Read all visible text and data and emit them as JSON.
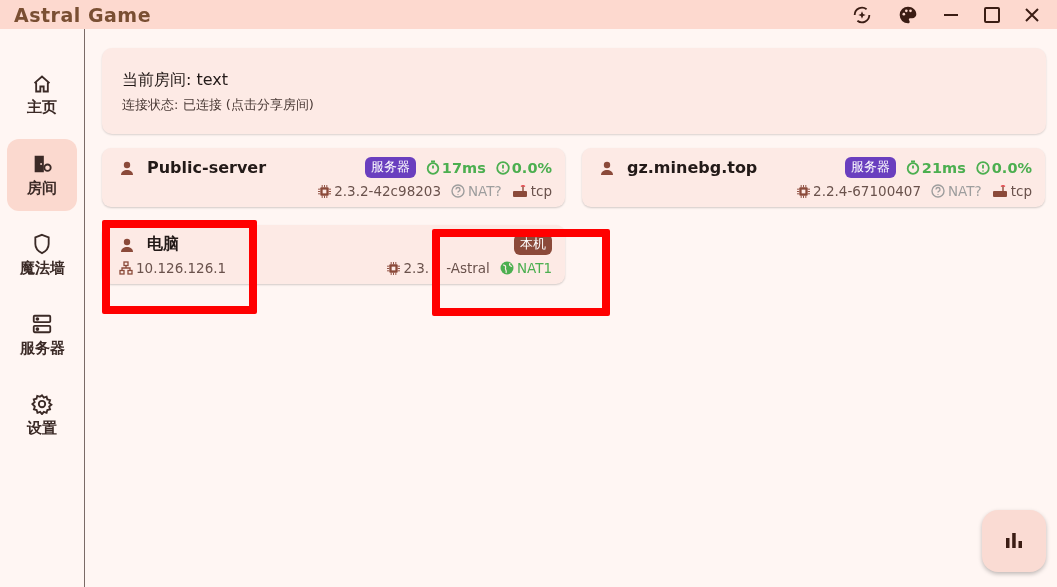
{
  "window": {
    "title": "Astral Game"
  },
  "sidebar": {
    "items": [
      {
        "label": "主页",
        "kind": "home",
        "selected": false
      },
      {
        "label": "房间",
        "kind": "room",
        "selected": true
      },
      {
        "label": "魔法墙",
        "kind": "shield",
        "selected": false
      },
      {
        "label": "服务器",
        "kind": "server",
        "selected": false
      },
      {
        "label": "设置",
        "kind": "gear",
        "selected": false
      }
    ]
  },
  "room": {
    "title": "当前房间: text",
    "status": "连接状态: 已连接 (点击分享房间)"
  },
  "peers": [
    {
      "kind": "server",
      "name": "Public-server",
      "badge": "服务器",
      "latency": "17ms",
      "loss": "0.0%",
      "version": "2.3.2-42c98203",
      "nat": "NAT?",
      "nat_known": false,
      "protocol": "tcp"
    },
    {
      "kind": "server",
      "name": "gz.minebg.top",
      "badge": "服务器",
      "latency": "21ms",
      "loss": "0.0%",
      "version": "2.2.4-67100407",
      "nat": "NAT?",
      "nat_known": false,
      "protocol": "tcp"
    },
    {
      "kind": "local",
      "name": "电脑",
      "badge": "本机",
      "ip": "10.126.126.1",
      "version": "2.3.",
      "version_tail": "-Astral",
      "nat": "NAT1",
      "nat_known": true
    }
  ]
}
